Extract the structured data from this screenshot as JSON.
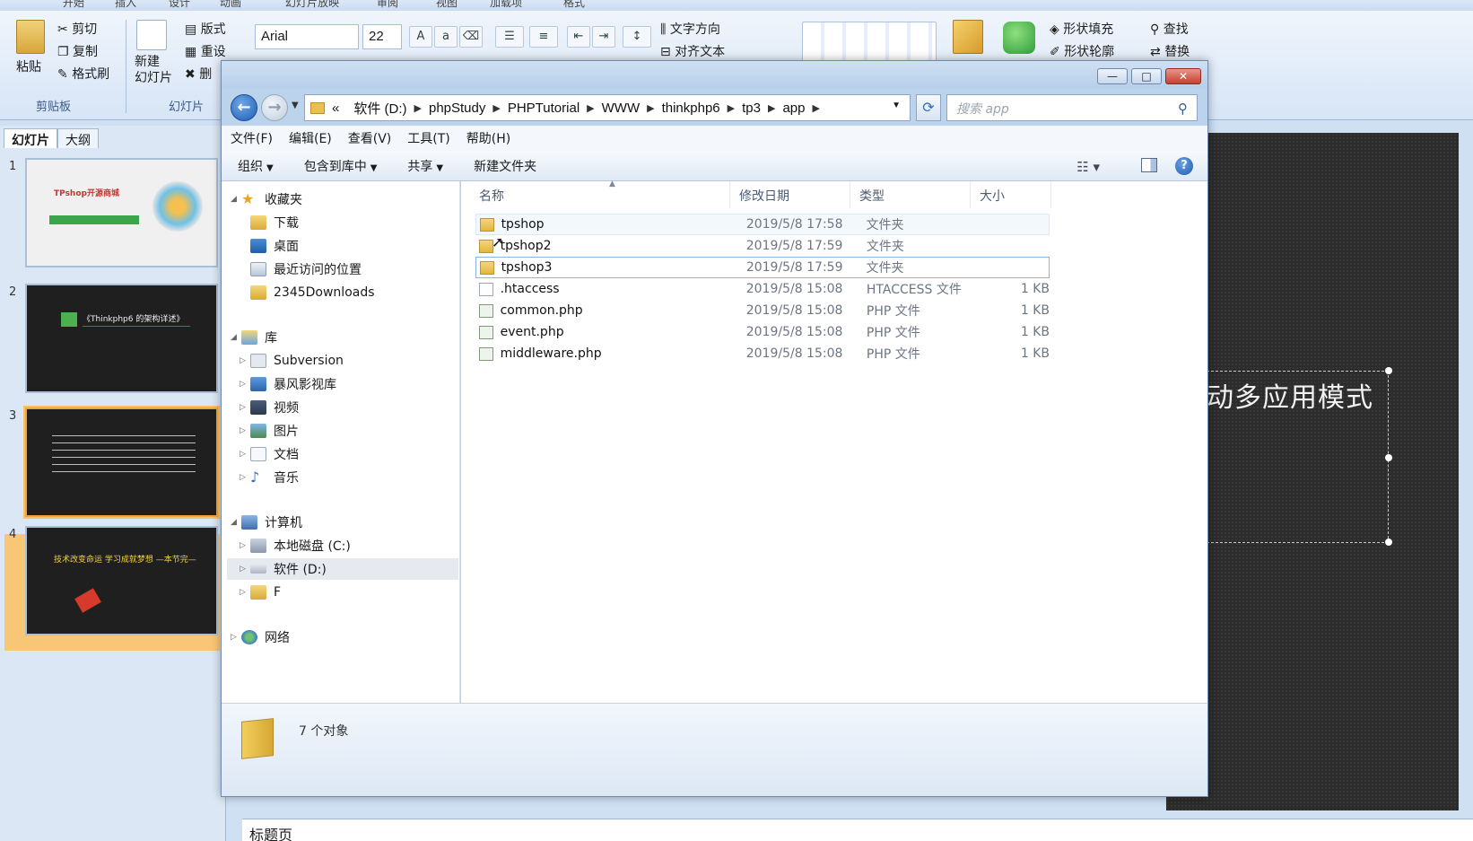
{
  "ppt": {
    "tabs": [
      "开始",
      "插入",
      "设计",
      "动画",
      "幻灯片放映",
      "审阅",
      "视图",
      "加载项",
      "格式"
    ],
    "ribbon": {
      "paste": "粘贴",
      "cut": "剪切",
      "copy": "复制",
      "format_painter": "格式刷",
      "new_slide": "新建\n幻灯片",
      "layout": "版式",
      "reset": "重设",
      "delete": "删",
      "font_name": "Arial",
      "font_size": "22",
      "text_direction": "文字方向",
      "align_text": "对齐文本",
      "shape_fill": "形状填充",
      "shape_outline": "形状轮廓",
      "find": "查找",
      "replace": "替换",
      "group_clipboard": "剪贴板",
      "group_slides": "幻灯片"
    },
    "panel_tabs": {
      "slides": "幻灯片",
      "outline": "大纲"
    },
    "slides": [
      {
        "num": "1",
        "text": "TPshop开源商城"
      },
      {
        "num": "2",
        "text": "《Thinkphp6 的架构详述》"
      },
      {
        "num": "3",
        "text": ""
      },
      {
        "num": "4",
        "text": "技术改变命运    学习成就梦想  —本节完—"
      }
    ],
    "canvas_text": "动多应用模式",
    "notes_label": "标题页"
  },
  "explorer": {
    "window_controls": {
      "minimize": "—",
      "maximize": "□",
      "close": "✕"
    },
    "breadcrumb": [
      "软件 (D:)",
      "phpStudy",
      "PHPTutorial",
      "WWW",
      "thinkphp6",
      "tp3",
      "app"
    ],
    "breadcrumb_prefix": "«",
    "search_placeholder": "搜索 app",
    "menu": [
      "文件(F)",
      "编辑(E)",
      "查看(V)",
      "工具(T)",
      "帮助(H)"
    ],
    "commands": {
      "organize": "组织",
      "include_in_library": "包含到库中",
      "share": "共享",
      "new_folder": "新建文件夹"
    },
    "nav": {
      "favorites": "收藏夹",
      "downloads": "下载",
      "desktop": "桌面",
      "recent": "最近访问的位置",
      "downloads2345": "2345Downloads",
      "libraries": "库",
      "subversion": "Subversion",
      "baofeng": "暴风影视库",
      "videos": "视频",
      "pictures": "图片",
      "documents": "文档",
      "music": "音乐",
      "computer": "计算机",
      "local_c": "本地磁盘 (C:)",
      "soft_d": "软件 (D:)",
      "drive_f": "F",
      "network": "网络"
    },
    "columns": {
      "name": "名称",
      "modified": "修改日期",
      "type": "类型",
      "size": "大小"
    },
    "files": [
      {
        "name": "tpshop",
        "date": "2019/5/8 17:58",
        "type": "文件夹",
        "size": "",
        "kind": "folder"
      },
      {
        "name": "tpshop2",
        "date": "2019/5/8 17:59",
        "type": "文件夹",
        "size": "",
        "kind": "folder"
      },
      {
        "name": "tpshop3",
        "date": "2019/5/8 17:59",
        "type": "文件夹",
        "size": "",
        "kind": "folder"
      },
      {
        "name": ".htaccess",
        "date": "2019/5/8 15:08",
        "type": "HTACCESS 文件",
        "size": "1 KB",
        "kind": "file"
      },
      {
        "name": "common.php",
        "date": "2019/5/8 15:08",
        "type": "PHP 文件",
        "size": "1 KB",
        "kind": "php"
      },
      {
        "name": "event.php",
        "date": "2019/5/8 15:08",
        "type": "PHP 文件",
        "size": "1 KB",
        "kind": "php"
      },
      {
        "name": "middleware.php",
        "date": "2019/5/8 15:08",
        "type": "PHP 文件",
        "size": "1 KB",
        "kind": "php"
      }
    ],
    "status": "7 个对象"
  },
  "colors": {
    "accent": "#1e5fb4",
    "selection": "#f3a436",
    "canvas": "#2c2c2c"
  }
}
